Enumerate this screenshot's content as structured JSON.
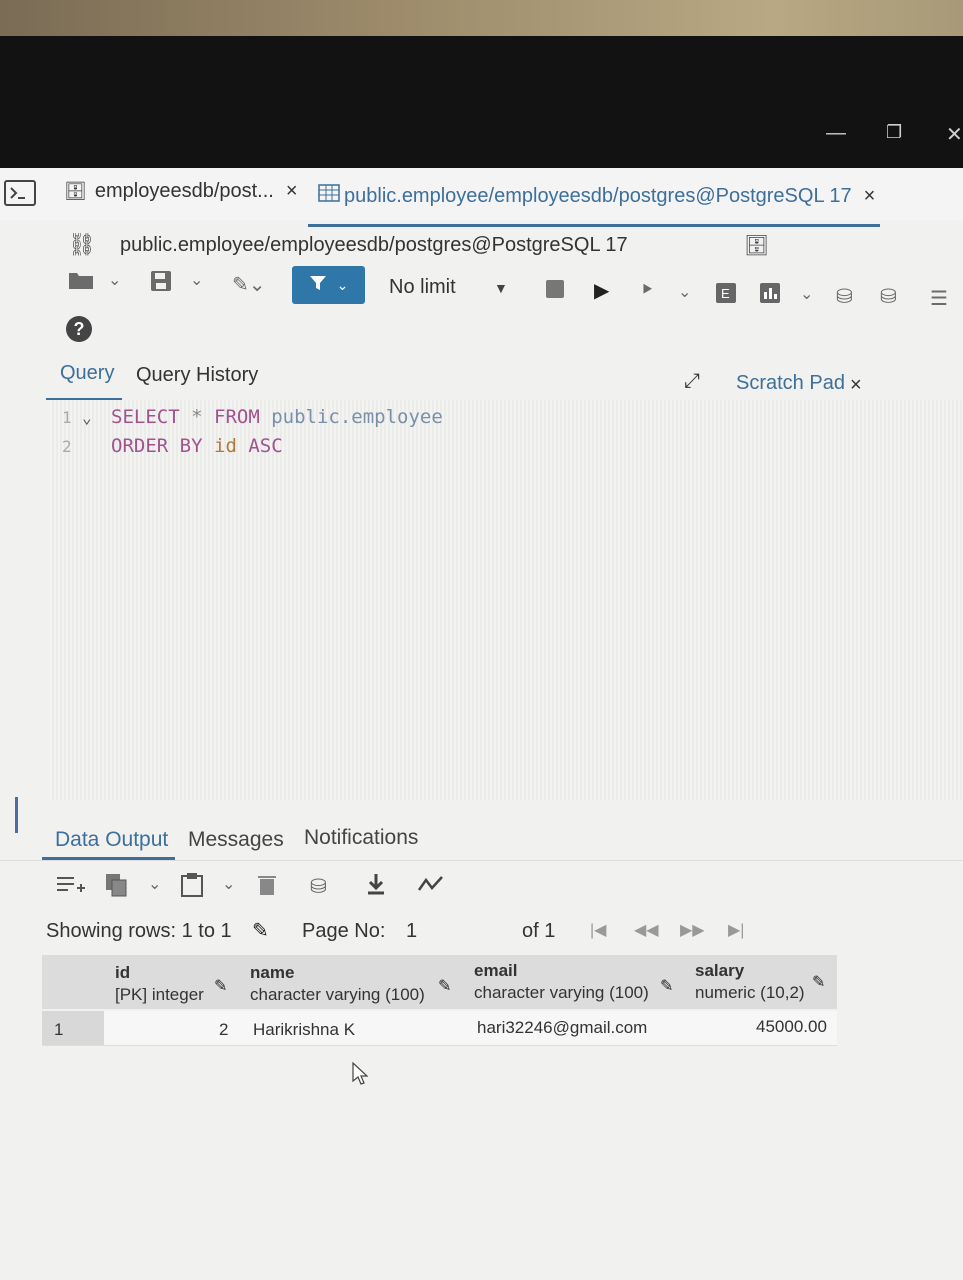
{
  "window": {
    "minimize_glyph": "—",
    "restore_glyph": "❐",
    "close_glyph": "✕"
  },
  "tabs": [
    {
      "label": "employeesdb/post...",
      "icon": "database-icon",
      "close": "×"
    },
    {
      "label": "public.employee/employeesdb/postgres@PostgreSQL 17",
      "icon": "table-icon",
      "close": "×"
    }
  ],
  "connection": {
    "label": "public.employee/employeesdb/postgres@PostgreSQL 17"
  },
  "toolbar": {
    "row_limit": "No limit"
  },
  "query_tabs": {
    "query": "Query",
    "history": "Query History",
    "scratch_pad": "Scratch Pad",
    "scratch_close": "×"
  },
  "editor": {
    "lines": [
      {
        "num": "1",
        "tokens": [
          "SELECT",
          "*",
          "FROM",
          "public.employee"
        ]
      },
      {
        "num": "2",
        "tokens": [
          "ORDER",
          "BY",
          "id",
          "ASC"
        ]
      }
    ]
  },
  "output_tabs": {
    "data_output": "Data Output",
    "messages": "Messages",
    "notifications": "Notifications"
  },
  "pager": {
    "showing": "Showing rows: 1 to 1",
    "page_no_label": "Page No:",
    "page_no": "1",
    "of_pages": "of 1"
  },
  "grid": {
    "columns": [
      {
        "name": "id",
        "type": "[PK] integer"
      },
      {
        "name": "name",
        "type": "character varying (100)"
      },
      {
        "name": "email",
        "type": "character varying (100)"
      },
      {
        "name": "salary",
        "type": "numeric (10,2)"
      }
    ],
    "rows": [
      {
        "row": "1",
        "id": "2",
        "name": "Harikrishna K",
        "email": "hari32246@gmail.com",
        "salary": "45000.00"
      }
    ]
  },
  "colors": {
    "accent": "#3d6f9a",
    "filter_button": "#2f77a8",
    "keyword": "#a2538e"
  }
}
